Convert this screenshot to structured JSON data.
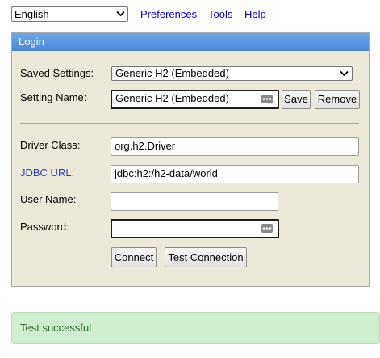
{
  "topbar": {
    "language": "English",
    "links": [
      "Preferences",
      "Tools",
      "Help"
    ]
  },
  "login": {
    "header": "Login",
    "saved_settings_label": "Saved Settings:",
    "saved_settings_value": "Generic H2 (Embedded)",
    "setting_name_label": "Setting Name:",
    "setting_name_value": "Generic H2 (Embedded)",
    "save_button": "Save",
    "remove_button": "Remove",
    "driver_class_label": "Driver Class:",
    "driver_class_value": "org.h2.Driver",
    "jdbc_url_label": "JDBC URL:",
    "jdbc_url_value": "jdbc:h2:/h2-data/world",
    "user_name_label": "User Name:",
    "user_name_value": "",
    "password_label": "Password:",
    "password_value": "",
    "connect_button": "Connect",
    "test_connection_button": "Test Connection"
  },
  "status": {
    "message": "Test successful"
  },
  "colors": {
    "header_blue": "#4a86d4",
    "panel_bg": "#ece9d8",
    "link_blue": "#0000cc",
    "success_bg": "#cfeecf",
    "success_text": "#2b6a2b"
  }
}
